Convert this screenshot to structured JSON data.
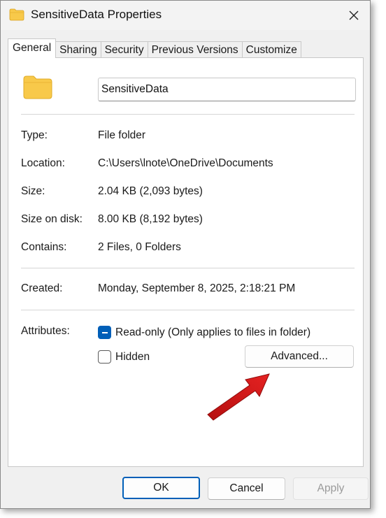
{
  "window": {
    "title": "SensitiveData Properties",
    "close_icon": "close-icon"
  },
  "tabs": [
    {
      "label": "General",
      "active": true
    },
    {
      "label": "Sharing",
      "active": false
    },
    {
      "label": "Security",
      "active": false
    },
    {
      "label": "Previous Versions",
      "active": false
    },
    {
      "label": "Customize",
      "active": false
    }
  ],
  "general": {
    "folder_name": "SensitiveData",
    "properties": [
      {
        "label": "Type:",
        "value": "File folder"
      },
      {
        "label": "Location:",
        "value": "C:\\Users\\lnote\\OneDrive\\Documents"
      },
      {
        "label": "Size:",
        "value": "2.04 KB (2,093 bytes)"
      },
      {
        "label": "Size on disk:",
        "value": "8.00 KB (8,192 bytes)"
      },
      {
        "label": "Contains:",
        "value": "2 Files, 0 Folders"
      }
    ],
    "created": {
      "label": "Created:",
      "value": "Monday, September 8, 2025, 2:18:21 PM"
    },
    "attributes": {
      "label": "Attributes:",
      "readonly": {
        "label": "Read-only (Only applies to files in folder)",
        "state": "indeterminate"
      },
      "hidden": {
        "label": "Hidden",
        "state": "unchecked"
      },
      "advanced_label": "Advanced..."
    }
  },
  "buttons": {
    "ok": "OK",
    "cancel": "Cancel",
    "apply": "Apply"
  },
  "colors": {
    "accent": "#005fb8",
    "folder": "#f8c94a",
    "arrow": "#d91a1a"
  }
}
